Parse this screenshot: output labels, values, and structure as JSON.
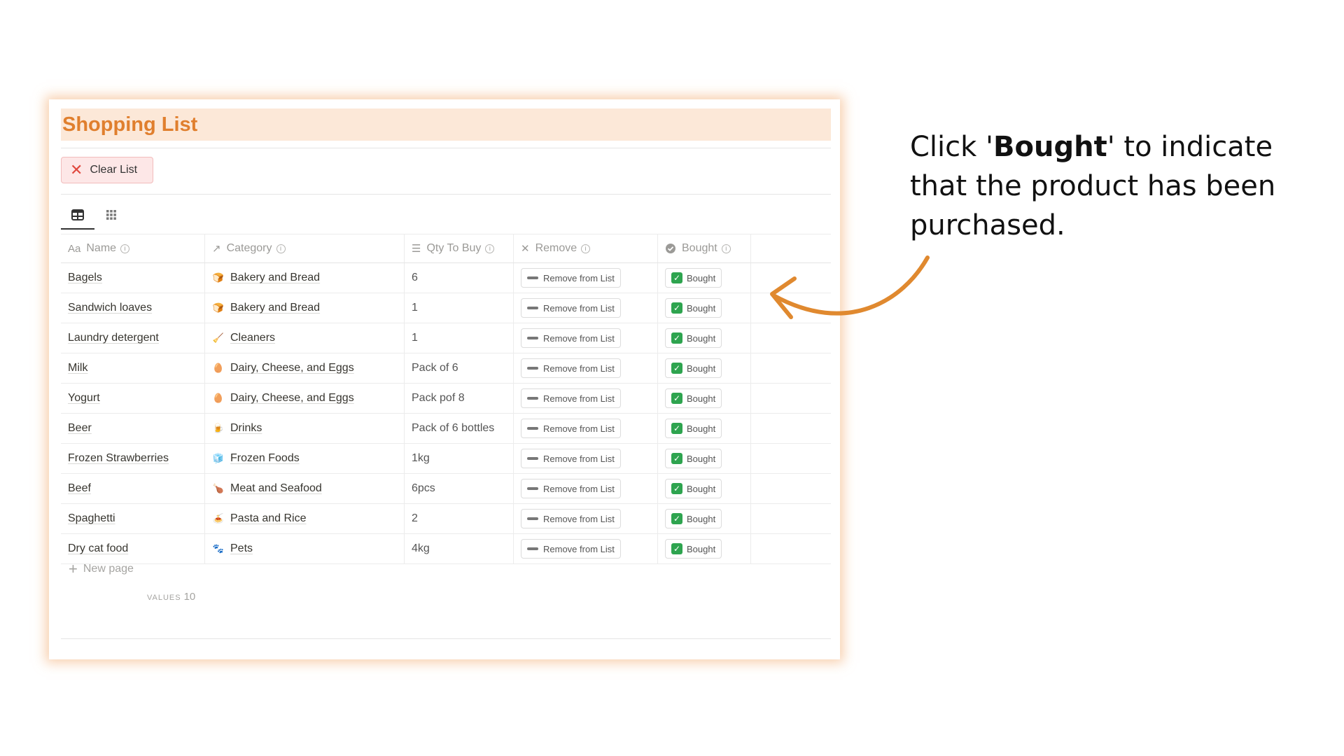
{
  "title": "Shopping List",
  "clear_button": "Clear List",
  "columns": {
    "name": "Name",
    "name_prefix": "Aa",
    "category": "Category",
    "qty": "Qty To Buy",
    "remove": "Remove",
    "bought": "Bought"
  },
  "rows": [
    {
      "name": "Bagels",
      "category": "Bakery and Bread",
      "emoji": "🍞",
      "qty": "6"
    },
    {
      "name": "Sandwich loaves",
      "category": "Bakery and Bread",
      "emoji": "🍞",
      "qty": "1"
    },
    {
      "name": "Laundry detergent",
      "category": "Cleaners",
      "emoji": "🧹",
      "qty": "1"
    },
    {
      "name": "Milk",
      "category": "Dairy, Cheese, and Eggs",
      "emoji": "🥚",
      "qty": "Pack of 6"
    },
    {
      "name": "Yogurt",
      "category": "Dairy, Cheese, and Eggs",
      "emoji": "🥚",
      "qty": "Pack pof 8"
    },
    {
      "name": "Beer",
      "category": "Drinks",
      "emoji": "🍺",
      "qty": "Pack of 6 bottles"
    },
    {
      "name": "Frozen Strawberries",
      "category": "Frozen Foods",
      "emoji": "🧊",
      "qty": "1kg"
    },
    {
      "name": "Beef",
      "category": "Meat and Seafood",
      "emoji": "🍗",
      "qty": "6pcs"
    },
    {
      "name": "Spaghetti",
      "category": "Pasta and Rice",
      "emoji": "🍝",
      "qty": "2"
    },
    {
      "name": "Dry cat food",
      "category": "Pets",
      "emoji": "🐾",
      "qty": "4kg"
    }
  ],
  "remove_label": "Remove from List",
  "bought_label": "Bought",
  "new_page": "New page",
  "values_label": "VALUES",
  "values_count": "10",
  "annotation": {
    "before": "Click '",
    "bold": "Bought",
    "after": "' to indicate that the product has been purchased."
  },
  "colors": {
    "accent": "#e07f2e",
    "title_bg": "#fce8d8",
    "arrow": "#e0892f",
    "check": "#2ea44f"
  }
}
